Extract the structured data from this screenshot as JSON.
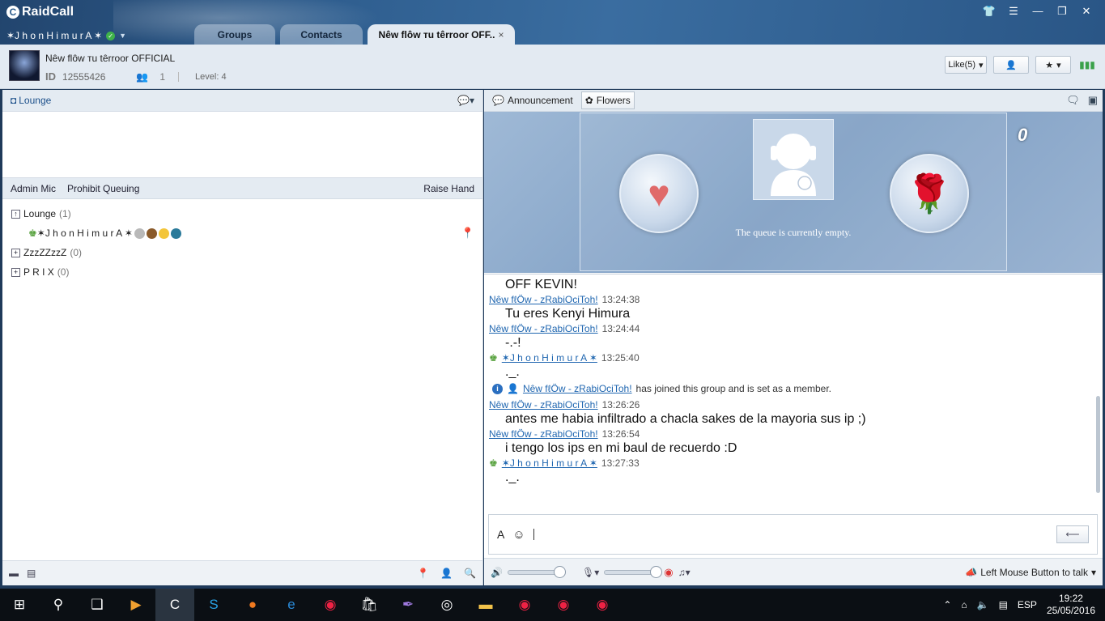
{
  "app": {
    "name": "RaidCall"
  },
  "user": {
    "nickname": "✶J h o  n H i m u r A ✶"
  },
  "tabs": [
    {
      "label": "Groups"
    },
    {
      "label": "Contacts"
    },
    {
      "label": "Nêw flôw тu têrroor OFF.."
    }
  ],
  "group": {
    "name": "Nêw flôw тu têrroor OFFICIAL",
    "id_label": "ID",
    "id": "12555426",
    "members": "1",
    "level": "Level: 4",
    "like": "Like(5)"
  },
  "left": {
    "channel": "Lounge",
    "mic": {
      "admin": "Admin Mic",
      "prohibit": "Prohibit Queuing",
      "raise": "Raise Hand"
    },
    "tree": [
      {
        "name": "Lounge",
        "count": "(1)",
        "expander": "↑"
      },
      {
        "name": "ZzzZZzzZ",
        "count": "(0)",
        "expander": "+"
      },
      {
        "name": "P R I X",
        "count": "(0)",
        "expander": "+"
      }
    ],
    "member": "✶J h o  n H i m u r A ✶"
  },
  "right": {
    "announcement": "Announcement",
    "flowers": "Flowers",
    "flower_count": "0",
    "queue_text": "The queue is currently empty."
  },
  "chat": {
    "partial_text": "OFF KEVIN!",
    "messages": [
      {
        "sender": "Nêw fℓÖw - zRabiOciToh!",
        "time": "13:24:38",
        "text": "Tu eres Kenyi Himura"
      },
      {
        "sender": "Nêw fℓÖw - zRabiOciToh!",
        "time": "13:24:44",
        "text": "-.-!"
      },
      {
        "sender": "✶J h o  n H i m u r A ✶",
        "time": "13:25:40",
        "text": "._."
      }
    ],
    "system": {
      "name": "Nêw fℓÖw - zRabiOciToh!",
      "text": "has joined this group and is set as a member."
    },
    "messages2": [
      {
        "sender": "Nêw fℓÖw - zRabiOciToh!",
        "time": "13:26:26",
        "text": "antes me habia infiltrado a chacla sakes de la mayoria sus ip ;)"
      },
      {
        "sender": "Nêw fℓÖw - zRabiOciToh!",
        "time": "13:26:54",
        "text": "i tengo los ips en mi baul de recuerdo :D"
      },
      {
        "sender": "✶J h o  n H i m u r A ✶",
        "time": "13:27:33",
        "text": "._."
      }
    ]
  },
  "footer": {
    "talk": "Left Mouse Button to talk"
  },
  "taskbar": {
    "lang": "ESP",
    "time": "19:22",
    "date": "25/05/2016"
  },
  "colors": {
    "accent": "#2b5b8c",
    "link": "#1f66b0",
    "taskbar": "#0b0f14"
  }
}
